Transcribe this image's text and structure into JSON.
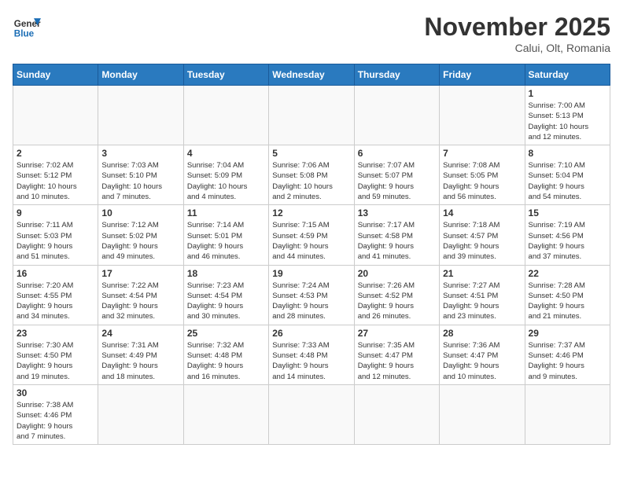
{
  "header": {
    "logo_general": "General",
    "logo_blue": "Blue",
    "month_title": "November 2025",
    "location": "Calui, Olt, Romania"
  },
  "weekdays": [
    "Sunday",
    "Monday",
    "Tuesday",
    "Wednesday",
    "Thursday",
    "Friday",
    "Saturday"
  ],
  "days": [
    {
      "date": "",
      "info": ""
    },
    {
      "date": "",
      "info": ""
    },
    {
      "date": "",
      "info": ""
    },
    {
      "date": "",
      "info": ""
    },
    {
      "date": "",
      "info": ""
    },
    {
      "date": "",
      "info": ""
    },
    {
      "date": "1",
      "info": "Sunrise: 7:00 AM\nSunset: 5:13 PM\nDaylight: 10 hours\nand 12 minutes."
    },
    {
      "date": "2",
      "info": "Sunrise: 7:02 AM\nSunset: 5:12 PM\nDaylight: 10 hours\nand 10 minutes."
    },
    {
      "date": "3",
      "info": "Sunrise: 7:03 AM\nSunset: 5:10 PM\nDaylight: 10 hours\nand 7 minutes."
    },
    {
      "date": "4",
      "info": "Sunrise: 7:04 AM\nSunset: 5:09 PM\nDaylight: 10 hours\nand 4 minutes."
    },
    {
      "date": "5",
      "info": "Sunrise: 7:06 AM\nSunset: 5:08 PM\nDaylight: 10 hours\nand 2 minutes."
    },
    {
      "date": "6",
      "info": "Sunrise: 7:07 AM\nSunset: 5:07 PM\nDaylight: 9 hours\nand 59 minutes."
    },
    {
      "date": "7",
      "info": "Sunrise: 7:08 AM\nSunset: 5:05 PM\nDaylight: 9 hours\nand 56 minutes."
    },
    {
      "date": "8",
      "info": "Sunrise: 7:10 AM\nSunset: 5:04 PM\nDaylight: 9 hours\nand 54 minutes."
    },
    {
      "date": "9",
      "info": "Sunrise: 7:11 AM\nSunset: 5:03 PM\nDaylight: 9 hours\nand 51 minutes."
    },
    {
      "date": "10",
      "info": "Sunrise: 7:12 AM\nSunset: 5:02 PM\nDaylight: 9 hours\nand 49 minutes."
    },
    {
      "date": "11",
      "info": "Sunrise: 7:14 AM\nSunset: 5:01 PM\nDaylight: 9 hours\nand 46 minutes."
    },
    {
      "date": "12",
      "info": "Sunrise: 7:15 AM\nSunset: 4:59 PM\nDaylight: 9 hours\nand 44 minutes."
    },
    {
      "date": "13",
      "info": "Sunrise: 7:17 AM\nSunset: 4:58 PM\nDaylight: 9 hours\nand 41 minutes."
    },
    {
      "date": "14",
      "info": "Sunrise: 7:18 AM\nSunset: 4:57 PM\nDaylight: 9 hours\nand 39 minutes."
    },
    {
      "date": "15",
      "info": "Sunrise: 7:19 AM\nSunset: 4:56 PM\nDaylight: 9 hours\nand 37 minutes."
    },
    {
      "date": "16",
      "info": "Sunrise: 7:20 AM\nSunset: 4:55 PM\nDaylight: 9 hours\nand 34 minutes."
    },
    {
      "date": "17",
      "info": "Sunrise: 7:22 AM\nSunset: 4:54 PM\nDaylight: 9 hours\nand 32 minutes."
    },
    {
      "date": "18",
      "info": "Sunrise: 7:23 AM\nSunset: 4:54 PM\nDaylight: 9 hours\nand 30 minutes."
    },
    {
      "date": "19",
      "info": "Sunrise: 7:24 AM\nSunset: 4:53 PM\nDaylight: 9 hours\nand 28 minutes."
    },
    {
      "date": "20",
      "info": "Sunrise: 7:26 AM\nSunset: 4:52 PM\nDaylight: 9 hours\nand 26 minutes."
    },
    {
      "date": "21",
      "info": "Sunrise: 7:27 AM\nSunset: 4:51 PM\nDaylight: 9 hours\nand 23 minutes."
    },
    {
      "date": "22",
      "info": "Sunrise: 7:28 AM\nSunset: 4:50 PM\nDaylight: 9 hours\nand 21 minutes."
    },
    {
      "date": "23",
      "info": "Sunrise: 7:30 AM\nSunset: 4:50 PM\nDaylight: 9 hours\nand 19 minutes."
    },
    {
      "date": "24",
      "info": "Sunrise: 7:31 AM\nSunset: 4:49 PM\nDaylight: 9 hours\nand 18 minutes."
    },
    {
      "date": "25",
      "info": "Sunrise: 7:32 AM\nSunset: 4:48 PM\nDaylight: 9 hours\nand 16 minutes."
    },
    {
      "date": "26",
      "info": "Sunrise: 7:33 AM\nSunset: 4:48 PM\nDaylight: 9 hours\nand 14 minutes."
    },
    {
      "date": "27",
      "info": "Sunrise: 7:35 AM\nSunset: 4:47 PM\nDaylight: 9 hours\nand 12 minutes."
    },
    {
      "date": "28",
      "info": "Sunrise: 7:36 AM\nSunset: 4:47 PM\nDaylight: 9 hours\nand 10 minutes."
    },
    {
      "date": "29",
      "info": "Sunrise: 7:37 AM\nSunset: 4:46 PM\nDaylight: 9 hours\nand 9 minutes."
    },
    {
      "date": "30",
      "info": "Sunrise: 7:38 AM\nSunset: 4:46 PM\nDaylight: 9 hours\nand 7 minutes."
    },
    {
      "date": "",
      "info": ""
    },
    {
      "date": "",
      "info": ""
    },
    {
      "date": "",
      "info": ""
    },
    {
      "date": "",
      "info": ""
    },
    {
      "date": "",
      "info": ""
    },
    {
      "date": "",
      "info": ""
    }
  ]
}
